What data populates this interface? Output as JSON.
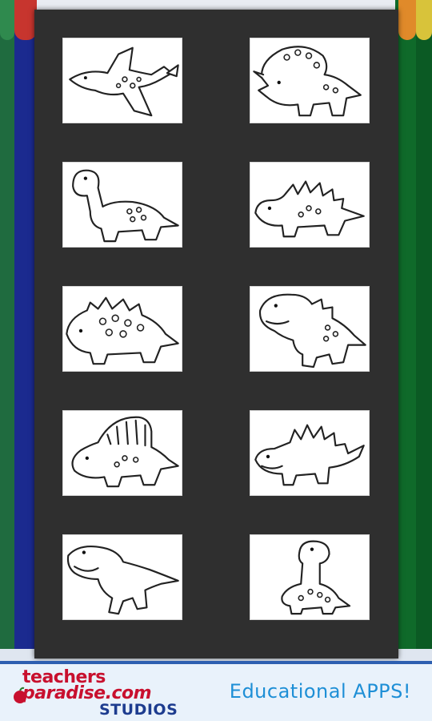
{
  "gallery": {
    "items": [
      {
        "name": "pterodactyl"
      },
      {
        "name": "triceratops"
      },
      {
        "name": "brontosaurus"
      },
      {
        "name": "stegosaurus"
      },
      {
        "name": "ankylosaurus"
      },
      {
        "name": "t-rex"
      },
      {
        "name": "dimetrodon"
      },
      {
        "name": "stegosaurus-2"
      },
      {
        "name": "raptor"
      },
      {
        "name": "brachiosaurus"
      }
    ]
  },
  "banner": {
    "logo_line1": "teachers",
    "logo_line2": "paradise.com",
    "logo_line3": "STUDIOS",
    "tagline": "Educational APPS!"
  },
  "colors": {
    "modal": "#2f2f2f",
    "banner_bg": "#e9f2fb",
    "logo_red": "#c8102e",
    "logo_blue": "#1d3c8f",
    "tagline": "#1e8fd6"
  }
}
